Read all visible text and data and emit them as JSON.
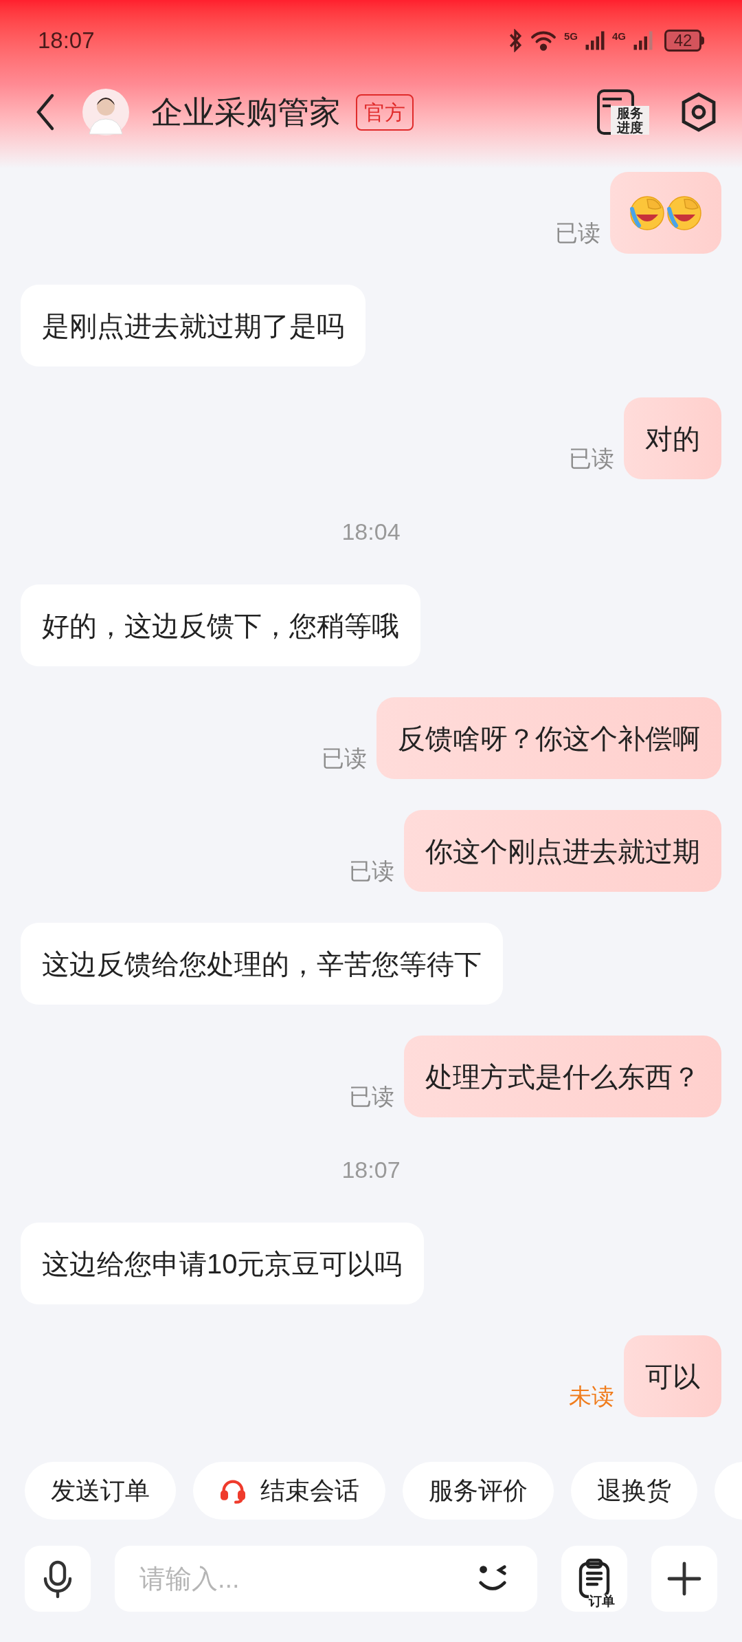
{
  "status_bar": {
    "time": "18:07",
    "network_1": "5G",
    "network_2": "4G",
    "battery": "42"
  },
  "header": {
    "title": "企业采购管家",
    "badge": "官方",
    "service_progress": "服务进度"
  },
  "messages": [
    {
      "kind": "sent_emoji",
      "emojis": [
        {
          "kind": "laugh_cry"
        },
        {
          "kind": "laugh_cry"
        }
      ],
      "read": true,
      "status": "已读"
    },
    {
      "kind": "received_text",
      "text": "是刚点进去就过期了是吗"
    },
    {
      "kind": "sent_text",
      "text": "对的",
      "read": true,
      "status": "已读"
    },
    {
      "kind": "time",
      "text": "18:04"
    },
    {
      "kind": "received_text",
      "text": "好的，这边反馈下，您稍等哦"
    },
    {
      "kind": "sent_text",
      "text": "反馈啥呀？你这个补偿啊",
      "read": true,
      "status": "已读"
    },
    {
      "kind": "sent_text",
      "text": "你这个刚点进去就过期",
      "read": true,
      "status": "已读"
    },
    {
      "kind": "received_text",
      "text": "这边反馈给您处理的，辛苦您等待下"
    },
    {
      "kind": "sent_text",
      "text": "处理方式是什么东西？",
      "read": true,
      "status": "已读"
    },
    {
      "kind": "time",
      "text": "18:07"
    },
    {
      "kind": "received_text",
      "text": "这边给您申请10元京豆可以吗"
    },
    {
      "kind": "sent_text",
      "text": "可以",
      "read": false,
      "status": "未读"
    }
  ],
  "quick_actions": [
    {
      "label": "发送订单",
      "kind": "plain"
    },
    {
      "label": "结束会话",
      "kind": "headset"
    },
    {
      "label": "服务评价",
      "kind": "plain"
    },
    {
      "label": "退换货",
      "kind": "plain"
    },
    {
      "kind": "cut"
    }
  ],
  "input": {
    "placeholder": "请输入...",
    "order_button": "订单"
  }
}
